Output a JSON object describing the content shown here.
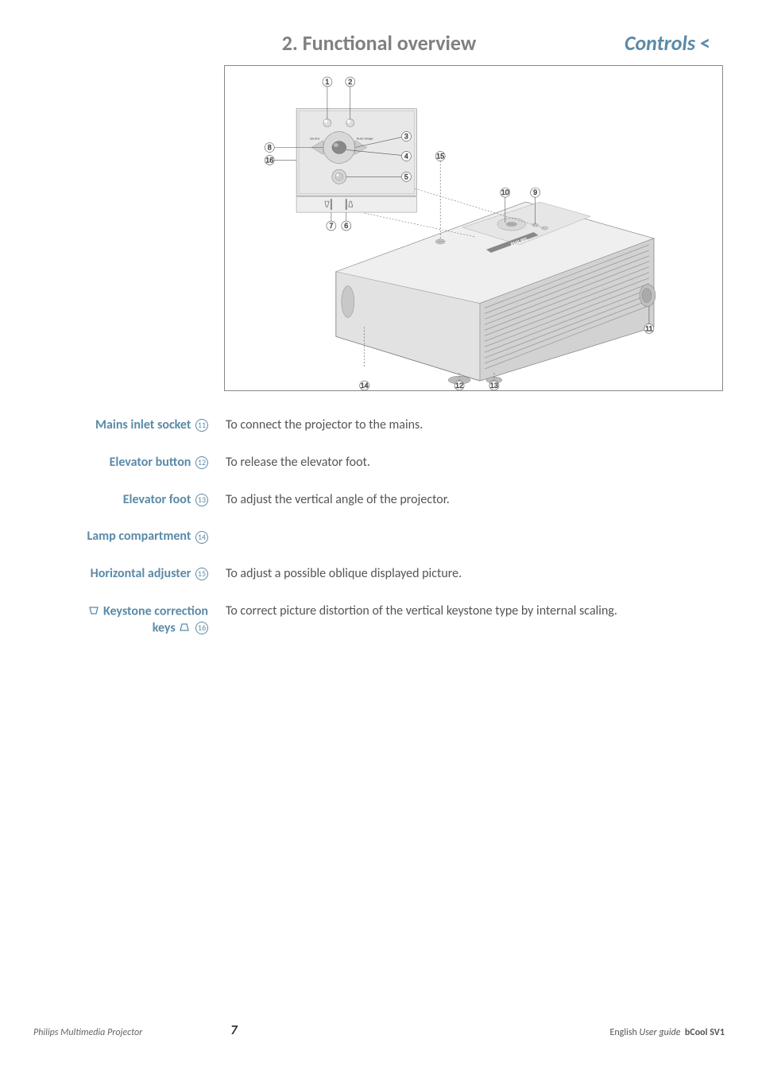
{
  "header": {
    "title": "2. Functional overview",
    "section": "Controls",
    "chev": "<"
  },
  "diagram": {
    "labels": {
      "source": "Source",
      "autoimage": "Auto Image"
    },
    "callouts": [
      "1",
      "2",
      "3",
      "4",
      "5",
      "6",
      "7",
      "8",
      "9",
      "10",
      "11",
      "12",
      "13",
      "14",
      "15",
      "16"
    ],
    "brand": "PHILIPS"
  },
  "rows": [
    {
      "label": "Mains inlet socket",
      "num": "11",
      "desc": "To connect the projector to the mains."
    },
    {
      "label": "Elevator button",
      "num": "12",
      "desc": "To release the elevator foot."
    },
    {
      "label": "Elevator foot",
      "num": "13",
      "desc": "To adjust the vertical angle of the projector."
    },
    {
      "label": "Lamp compartment",
      "num": "14",
      "desc": ""
    },
    {
      "label": "Horizontal adjuster",
      "num": "15",
      "desc": "To adjust a possible oblique displayed picture."
    },
    {
      "label_pre_icon": "down",
      "label": "Keystone correction",
      "label_line2": "keys",
      "label_line2_icon": "up",
      "num": "16",
      "desc": "To correct picture distortion of the vertical keystone type by internal scaling."
    }
  ],
  "footer": {
    "left": "Philips Multimedia Projector",
    "page": "7",
    "lang": "English",
    "guide": "User guide",
    "model": "bCool SV1"
  }
}
